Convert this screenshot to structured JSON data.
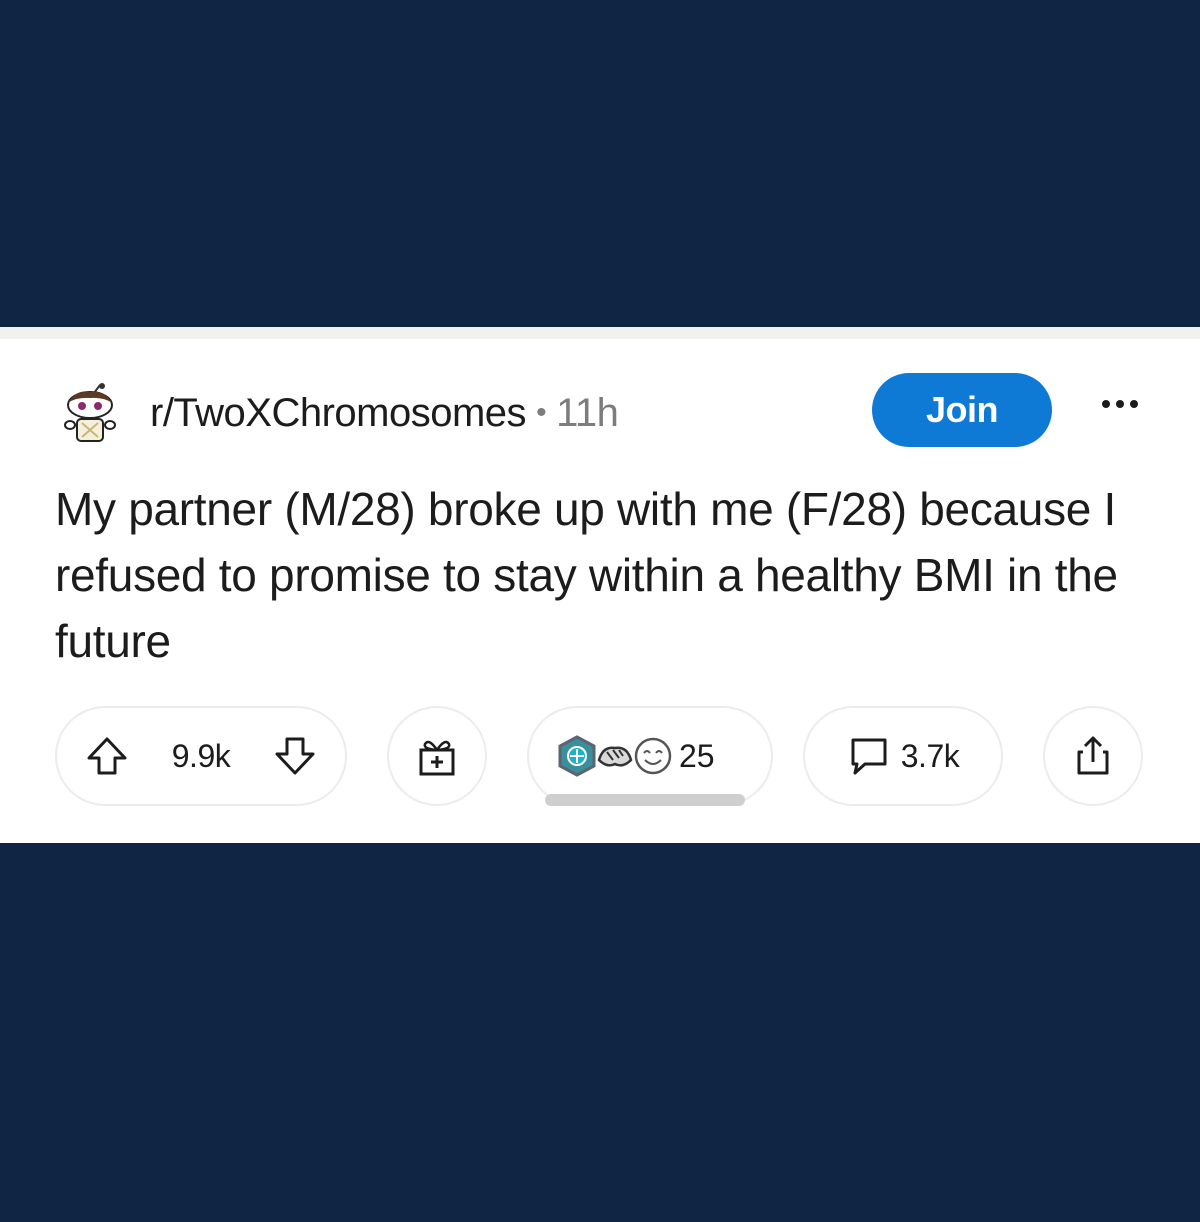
{
  "post": {
    "subreddit": "r/TwoXChromosomes",
    "separator": "•",
    "time_ago": "11h",
    "join_label": "Join",
    "title": "My partner (M/28) broke up with me (F/28) because I refused to promise to stay within a healthy BMI in the future"
  },
  "actions": {
    "upvote_icon": "arrow-up-outline-icon",
    "downvote_icon": "arrow-down-outline-icon",
    "vote_count": "9.9k",
    "gift_icon": "gift-box-icon",
    "award_count": "25",
    "comment_icon": "speech-bubble-icon",
    "comment_count": "3.7k",
    "share_icon": "share-arrow-up-icon",
    "more_icon": "three-dots-icon"
  },
  "colors": {
    "background": "#102543",
    "card": "#ffffff",
    "join_button": "#0f79d6",
    "meta_text": "#7c7c7c",
    "primary_text": "#1c1c1c"
  }
}
